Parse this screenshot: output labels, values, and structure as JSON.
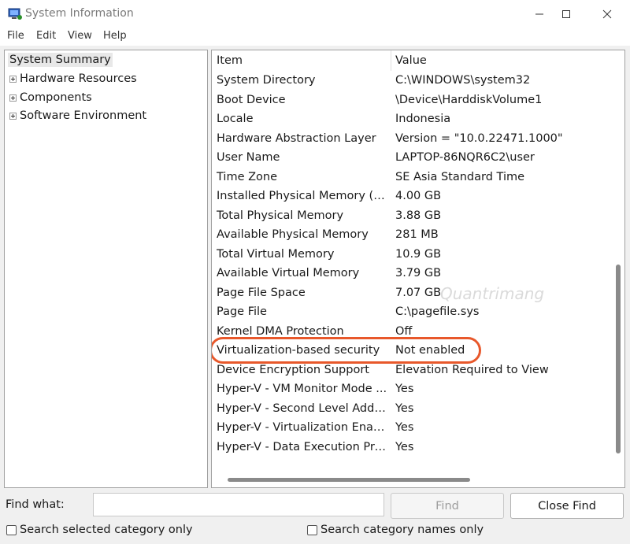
{
  "window": {
    "title": "System Information",
    "minimize_icon": "minimize-icon",
    "maximize_icon": "maximize-icon",
    "close_icon": "close-icon"
  },
  "menu": [
    "File",
    "Edit",
    "View",
    "Help"
  ],
  "tree": {
    "root": "System Summary",
    "children": [
      "Hardware Resources",
      "Components",
      "Software Environment"
    ]
  },
  "table": {
    "headers": [
      "Item",
      "Value"
    ],
    "rows": [
      [
        "System Directory",
        "C:\\WINDOWS\\system32"
      ],
      [
        "Boot Device",
        "\\Device\\HarddiskVolume1"
      ],
      [
        "Locale",
        "Indonesia"
      ],
      [
        "Hardware Abstraction Layer",
        "Version = \"10.0.22471.1000\""
      ],
      [
        "User Name",
        "LAPTOP-86NQR6C2\\user"
      ],
      [
        "Time Zone",
        "SE Asia Standard Time"
      ],
      [
        "Installed Physical Memory (RA...",
        "4.00 GB"
      ],
      [
        "Total Physical Memory",
        "3.88 GB"
      ],
      [
        "Available Physical Memory",
        "281 MB"
      ],
      [
        "Total Virtual Memory",
        "10.9 GB"
      ],
      [
        "Available Virtual Memory",
        "3.79 GB"
      ],
      [
        "Page File Space",
        "7.07 GB"
      ],
      [
        "Page File",
        "C:\\pagefile.sys"
      ],
      [
        "Kernel DMA Protection",
        "Off"
      ],
      [
        "Virtualization-based security",
        "Not enabled"
      ],
      [
        "Device Encryption Support",
        "Elevation Required to View"
      ],
      [
        "Hyper-V - VM Monitor Mode ...",
        "Yes"
      ],
      [
        "Hyper-V - Second Level Addre...",
        "Yes"
      ],
      [
        "Hyper-V - Virtualization Enabl...",
        "Yes"
      ],
      [
        "Hyper-V - Data Execution Pro...",
        "Yes"
      ]
    ]
  },
  "watermark": "Quantrimang",
  "find": {
    "label": "Find what:",
    "value": "",
    "find_button": "Find",
    "close_button": "Close Find",
    "search_selected": "Search selected category only",
    "search_names": "Search category names only"
  },
  "colors": {
    "highlight": "#e8582b"
  }
}
